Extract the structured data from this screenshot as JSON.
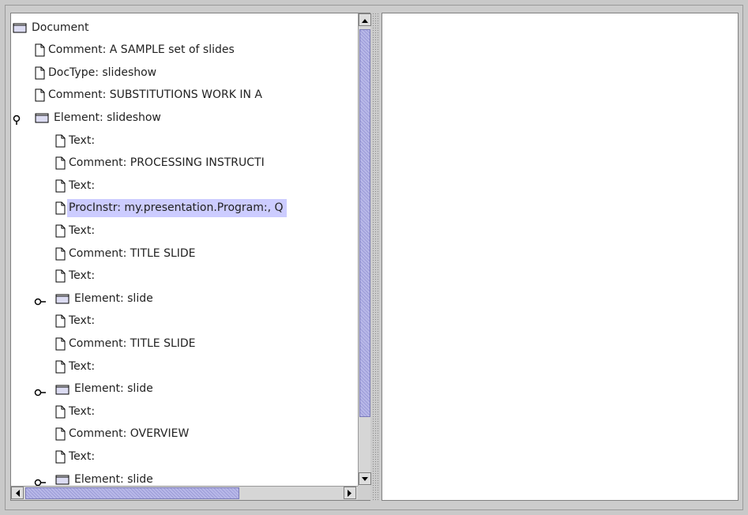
{
  "tree": {
    "selected_index": 9,
    "nodes": [
      {
        "label": "Document",
        "icon": "folder-icon",
        "depth": 0,
        "handle": "none"
      },
      {
        "label": "Comment: A SAMPLE set of slides",
        "icon": "document-icon",
        "depth": 1,
        "handle": "none"
      },
      {
        "label": "DocType: slideshow",
        "icon": "document-icon",
        "depth": 1,
        "handle": "none"
      },
      {
        "label": "Comment: SUBSTITUTIONS WORK IN A",
        "icon": "document-icon",
        "depth": 1,
        "handle": "none"
      },
      {
        "label": "Element: slideshow",
        "icon": "folder-icon",
        "depth": 1,
        "handle": "expanded"
      },
      {
        "label": "Text:",
        "icon": "document-icon",
        "depth": 2,
        "handle": "none"
      },
      {
        "label": "Comment: PROCESSING INSTRUCTI",
        "icon": "document-icon",
        "depth": 2,
        "handle": "none"
      },
      {
        "label": "Text:",
        "icon": "document-icon",
        "depth": 2,
        "handle": "none"
      },
      {
        "label": "ProcInstr: my.presentation.Program:, Q",
        "icon": "document-icon",
        "depth": 2,
        "handle": "none"
      },
      {
        "label": "Text:",
        "icon": "document-icon",
        "depth": 2,
        "handle": "none"
      },
      {
        "label": "Comment: TITLE SLIDE",
        "icon": "document-icon",
        "depth": 2,
        "handle": "none"
      },
      {
        "label": "Text:",
        "icon": "document-icon",
        "depth": 2,
        "handle": "none"
      },
      {
        "label": "Element: slide",
        "icon": "folder-icon",
        "depth": 2,
        "handle": "collapsed"
      },
      {
        "label": "Text:",
        "icon": "document-icon",
        "depth": 2,
        "handle": "none"
      },
      {
        "label": "Comment: TITLE SLIDE",
        "icon": "document-icon",
        "depth": 2,
        "handle": "none"
      },
      {
        "label": "Text:",
        "icon": "document-icon",
        "depth": 2,
        "handle": "none"
      },
      {
        "label": "Element: slide",
        "icon": "folder-icon",
        "depth": 2,
        "handle": "collapsed"
      },
      {
        "label": "Text:",
        "icon": "document-icon",
        "depth": 2,
        "handle": "none"
      },
      {
        "label": "Comment: OVERVIEW",
        "icon": "document-icon",
        "depth": 2,
        "handle": "none"
      },
      {
        "label": "Text:",
        "icon": "document-icon",
        "depth": 2,
        "handle": "none"
      },
      {
        "label": "Element: slide",
        "icon": "folder-icon",
        "depth": 2,
        "handle": "collapsed"
      }
    ]
  },
  "colors": {
    "selection": "#ccccff",
    "scroll_thumb": "#b8b8e8",
    "window_bg": "#cccccc"
  }
}
